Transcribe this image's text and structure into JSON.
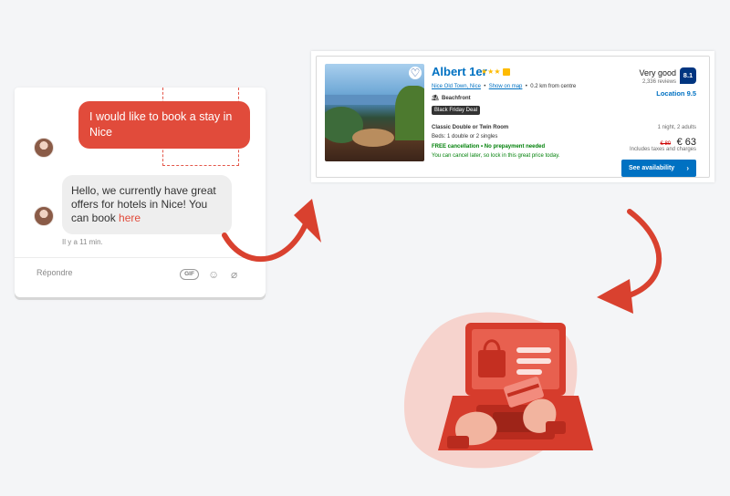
{
  "chat": {
    "user_message": "I would like to book a stay in Nice",
    "bot_message": "Hello, we currently have great offers for hotels in Nice! You can book",
    "bot_link": "here",
    "timestamp": "Il y a 11 min.",
    "reply_placeholder": "Répondre",
    "gif_label": "GIF",
    "icons": [
      "emoji-icon",
      "attachment-icon"
    ]
  },
  "hotel": {
    "name": "Albert 1er",
    "stars": "★★★",
    "location_link": "Nice Old Town, Nice",
    "map_link": "Show on map",
    "distance": "0.2 km from centre",
    "feature": "Beachfront",
    "deal_badge": "Black Friday Deal",
    "room_title": "Classic Double or Twin Room",
    "beds": "Beds: 1 double or 2 singles",
    "free_cancellation": "FREE cancellation • No prepayment needed",
    "cancel_note": "You can cancel later, so lock in this great price today.",
    "rating_word": "Very good",
    "reviews": "2,336 reviews",
    "score": "8.1",
    "location_score": "Location 9.5",
    "stay_info": "1 night, 2 adults",
    "old_price": "€ 80",
    "new_price": "€ 63",
    "taxes": "Includes taxes and charges",
    "cta": "See availability"
  },
  "colors": {
    "brand_red": "#e14b3b",
    "booking_blue": "#0071c2",
    "score_navy": "#003580",
    "green": "#008009"
  }
}
